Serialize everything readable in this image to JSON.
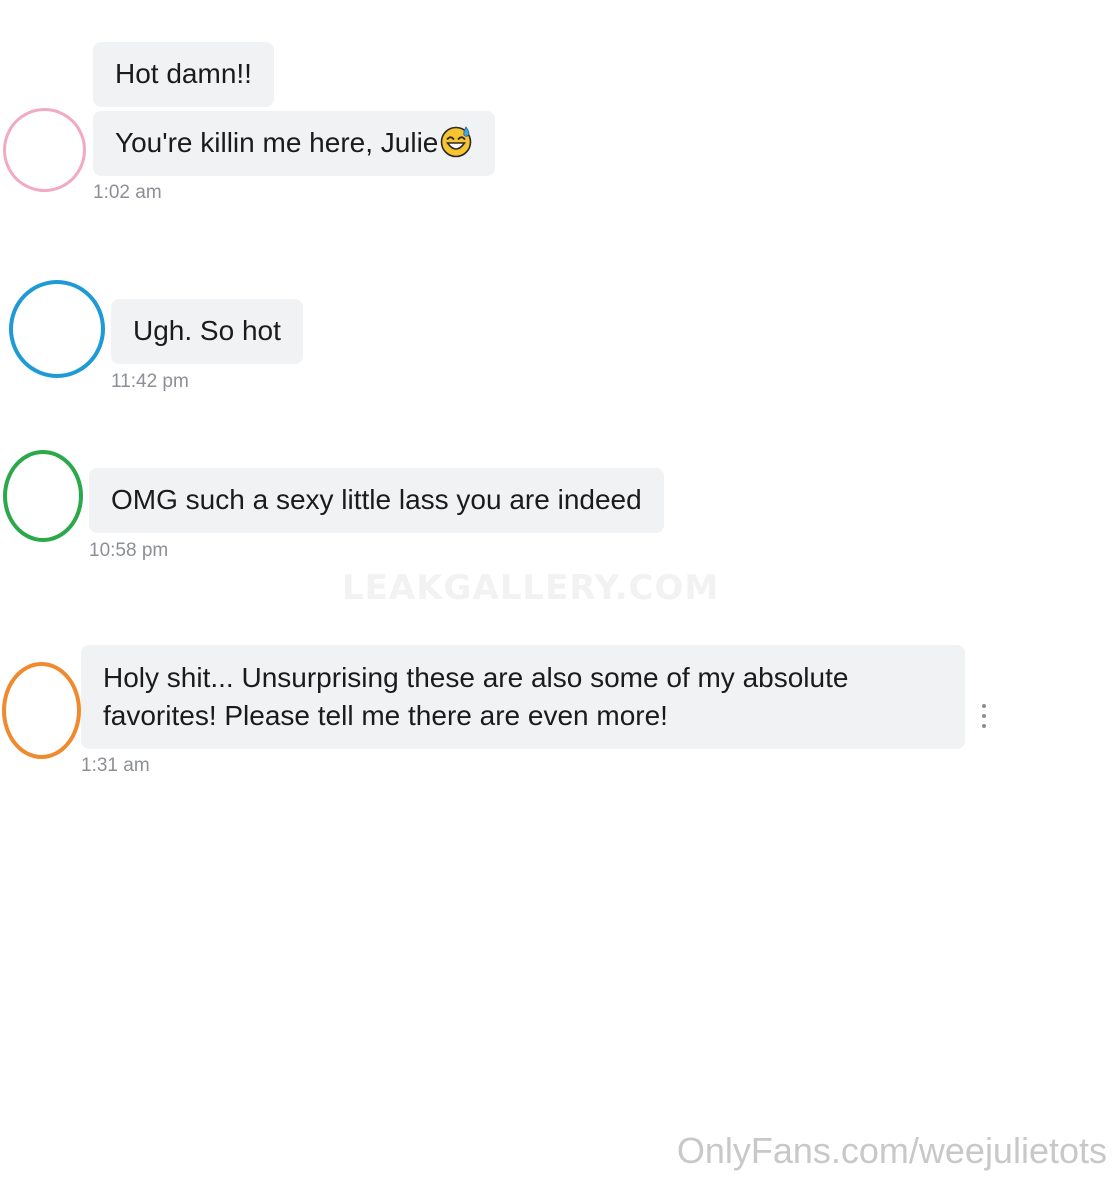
{
  "messages": [
    {
      "avatar_color": "#f2a9c4",
      "bubbles": [
        "Hot damn!!",
        "You're killin me here, Julie"
      ],
      "emoji": "sweat-smile-emoji",
      "time": "1:02 am"
    },
    {
      "avatar_color": "#1e9ad6",
      "bubbles": [
        "Ugh. So hot"
      ],
      "time": "11:42 pm"
    },
    {
      "avatar_color": "#2aa84a",
      "bubbles": [
        "OMG such a sexy little lass you are indeed"
      ],
      "time": "10:58 pm"
    },
    {
      "avatar_color": "#ef8a2e",
      "bubbles": [
        "Holy shit... Unsurprising these are also some of my absolute favorites! Please tell me there are even more!"
      ],
      "time": "1:31 am",
      "menu_icon": "more-vertical-icon"
    }
  ],
  "watermark": "LEAKGALLERY.COM",
  "credit": "OnlyFans.com/weejulietots"
}
